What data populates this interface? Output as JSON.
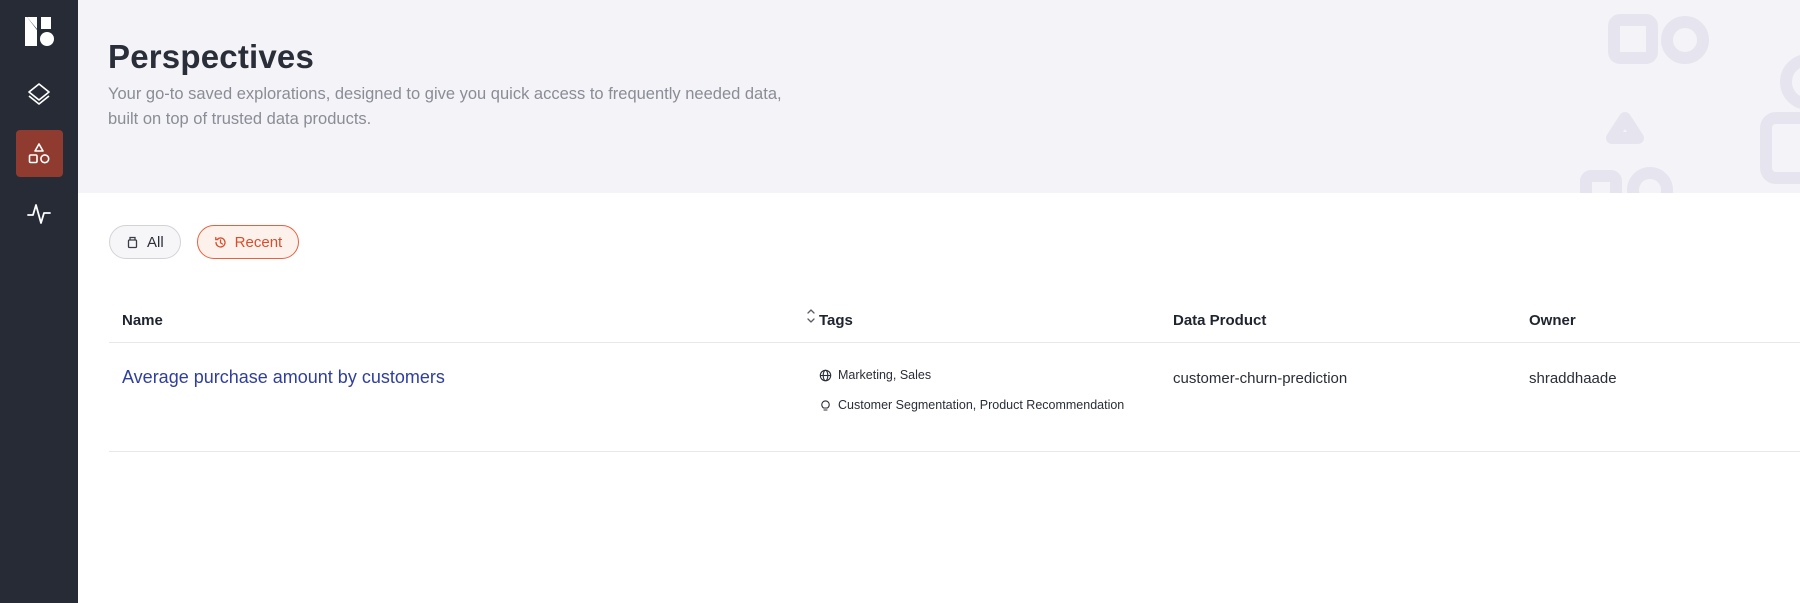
{
  "sidebar": {
    "logo_icon": "brand-logo-icon",
    "items": [
      {
        "id": "layers",
        "icon": "layers-icon",
        "active": false
      },
      {
        "id": "perspectives",
        "icon": "shapes-icon",
        "active": true
      },
      {
        "id": "activity",
        "icon": "activity-icon",
        "active": false
      }
    ],
    "colors": {
      "background": "#262b36",
      "active": "#8f3b2f"
    }
  },
  "header": {
    "title": "Perspectives",
    "description": "Your go-to saved explorations, designed to give you quick access to frequently needed data, built on top of trusted data products."
  },
  "filters": {
    "all_label": "All",
    "recent_label": "Recent",
    "selected": "Recent",
    "accent_color": "#e8603e"
  },
  "table": {
    "columns": {
      "name": "Name",
      "tags": "Tags",
      "data_product": "Data Product",
      "owner": "Owner"
    },
    "rows": [
      {
        "name": "Average purchase amount by customers",
        "domain_tags": "Marketing, Sales",
        "use_case_tags": "Customer Segmentation, Product Recommendation",
        "data_product": "customer-churn-prediction",
        "owner": "shraddhaade"
      }
    ]
  }
}
